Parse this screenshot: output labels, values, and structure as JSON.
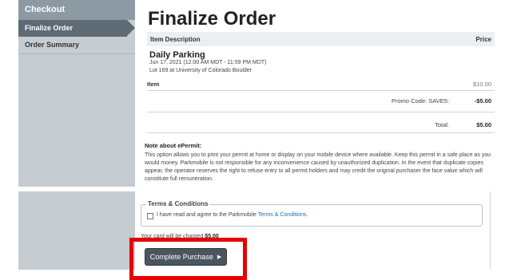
{
  "sidebar": {
    "title": "Checkout",
    "items": [
      {
        "label": "Finalize Order",
        "active": true
      },
      {
        "label": "Order Summary",
        "active": false
      }
    ]
  },
  "main": {
    "title": "Finalize Order",
    "table": {
      "header_description": "Item Description",
      "header_price": "Price",
      "item_name": "Daily Parking",
      "item_dates": "Jun 17, 2021 (12:00 AM MDT - 11:59 PM MDT)",
      "item_location": "Lot 169 at University of Colorado Boulder",
      "item_label": "Item",
      "item_price": "$10.00",
      "promo_label": "Promo Code: SAVE5:",
      "promo_value": "-$5.00",
      "total_label": "Total:",
      "total_value": "$5.00"
    },
    "note": {
      "title": "Note about ePermit:",
      "body": "This option allows you to print your permit at home or display on your mobile device where available. Keep this permit in a safe place as you would money. Parkmobile is not responsible for any inconvenience caused by unauthorized duplication. In the event that duplicate copies appear, the operator reserves the right to refuse entry to all permit holders and may credit the original purchaser the face value which will constitute full remuneration."
    }
  },
  "terms": {
    "legend": "Terms & Conditions",
    "agree_text": "I have read and agree to the Parkmobile ",
    "link_text": "Terms & Conditions.",
    "checked": false
  },
  "payment": {
    "charge_text": "Your card will be charged ",
    "charge_amount": "$5.00",
    "button_label": "Complete Purchase"
  },
  "colors": {
    "highlight": "#e60000",
    "button": "#4b5560",
    "link": "#1a6fb5"
  }
}
